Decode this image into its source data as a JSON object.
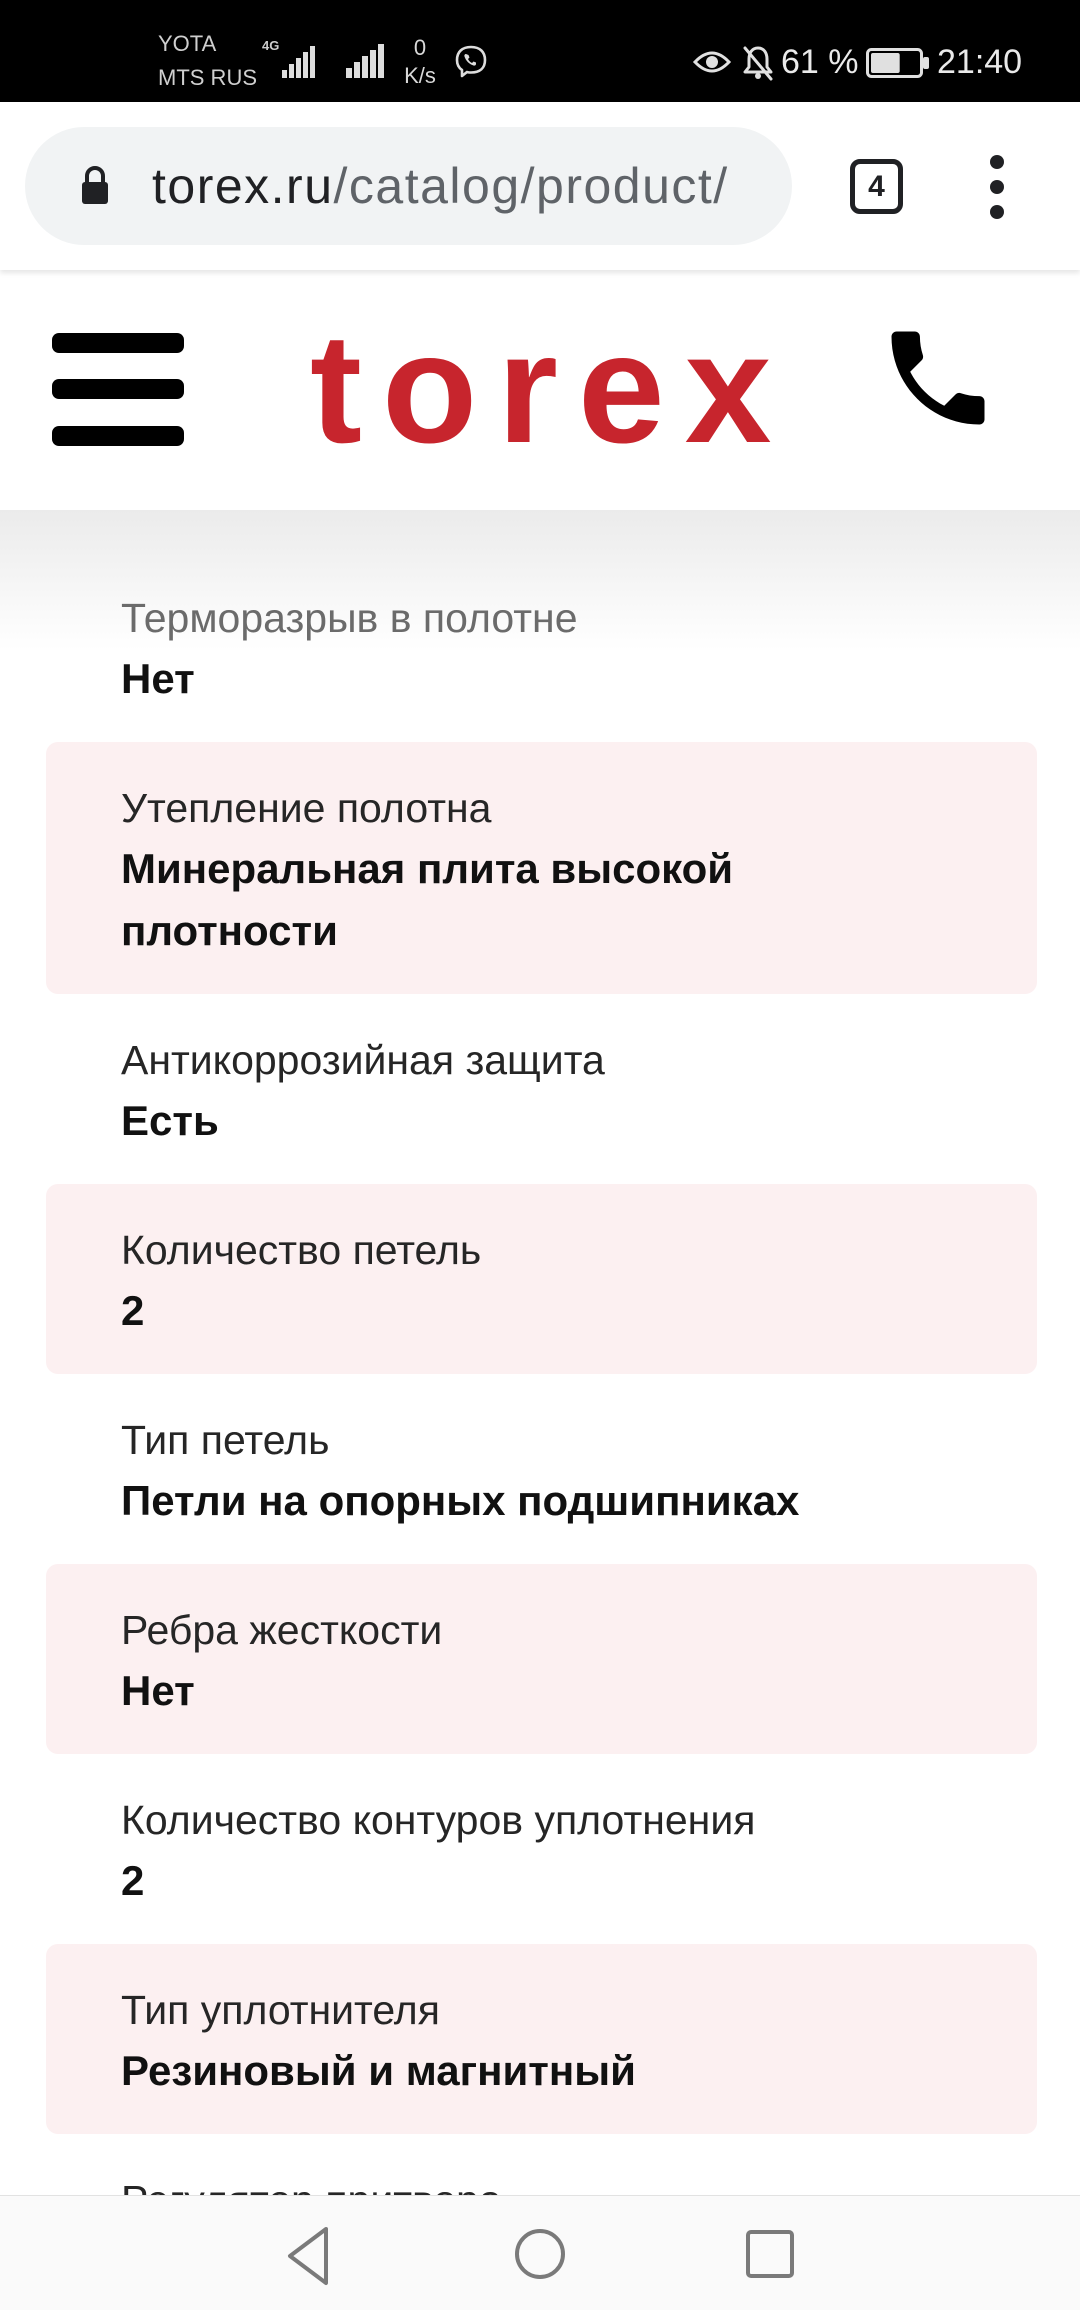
{
  "status_bar": {
    "carriers": [
      "YOTA",
      "MTS RUS"
    ],
    "network_type": "4G",
    "data_speed": {
      "value": "0",
      "unit": "K/s"
    },
    "battery_text": "61 %",
    "battery_level": 0.61,
    "time": "21:40",
    "icons": {
      "signal_primary": "signal-4g-icon",
      "signal_secondary": "signal-icon",
      "notification": "viber-icon",
      "eye_comfort": "eye-icon",
      "silent_mode": "bell-off-icon",
      "battery": "battery-icon"
    }
  },
  "browser": {
    "url_host": "torex.ru",
    "url_path": "/catalog/product/",
    "tab_count": "4",
    "icons": {
      "secure": "lock-icon",
      "tabs": "tab-switcher-icon",
      "menu": "more-vert-icon"
    }
  },
  "site_header": {
    "logo_text": "torex",
    "icons": {
      "menu": "hamburger-menu-icon",
      "call": "phone-icon"
    }
  },
  "specs": [
    {
      "label": "Терморазрыв в полотне",
      "value": "Нет"
    },
    {
      "label": "Утепление полотна",
      "value": "Минеральная плита высокой плотности"
    },
    {
      "label": "Антикоррозийная защита",
      "value": "Есть"
    },
    {
      "label": "Количество петель",
      "value": "2"
    },
    {
      "label": "Тип петель",
      "value": "Петли на опорных подшипниках"
    },
    {
      "label": "Ребра жесткости",
      "value": "Нет"
    },
    {
      "label": "Количество контуров уплотнения",
      "value": "2"
    },
    {
      "label": "Тип уплотнителя",
      "value": "Резиновый и магнитный"
    },
    {
      "label": "Регулятор притвора"
    }
  ],
  "nav_bar": {
    "icons": [
      "back-icon",
      "home-icon",
      "recents-icon"
    ]
  },
  "colors": {
    "brand_red": "#c7252d",
    "row_highlight": "#fcf0f1",
    "status_bar_bg": "#000000",
    "url_pill_bg": "#f1f3f4"
  }
}
